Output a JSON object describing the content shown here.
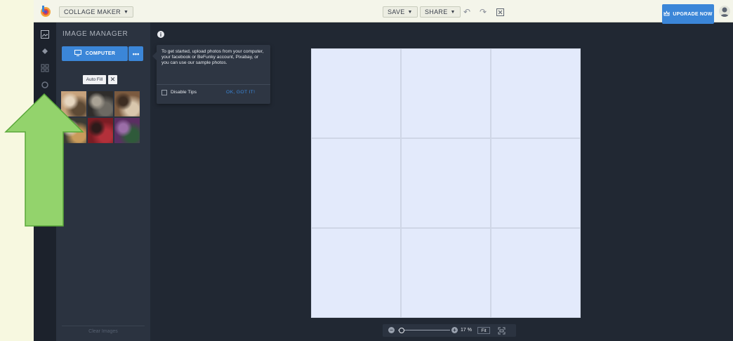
{
  "topbar": {
    "mode_label": "COLLAGE MAKER",
    "save_label": "SAVE",
    "share_label": "SHARE",
    "upgrade_label": "UPGRADE NOW"
  },
  "panel": {
    "title": "IMAGE MANAGER",
    "computer_label": "COMPUTER",
    "more_label": "•••",
    "autofill_label": "Auto Fill",
    "autofill_close": "✕",
    "clear_label": "Clear Images",
    "thumbnails": [
      {
        "name": "thumb-woman-portrait",
        "colors": [
          "#c7a27c",
          "#5e4a35",
          "#e6d6c0"
        ]
      },
      {
        "name": "thumb-headphones",
        "colors": [
          "#2f2d2b",
          "#6d6a63",
          "#a9a295"
        ]
      },
      {
        "name": "thumb-coffee",
        "colors": [
          "#7b5a3f",
          "#d9c7ad",
          "#3d2d22"
        ]
      },
      {
        "name": "thumb-bread-vegetables",
        "colors": [
          "#3a3a34",
          "#c99b5b",
          "#d8d0c2"
        ]
      },
      {
        "name": "thumb-raspberries",
        "colors": [
          "#7a1d24",
          "#b3303a",
          "#2d1a1a"
        ]
      },
      {
        "name": "thumb-purple-plant",
        "colors": [
          "#5b2e62",
          "#2f5a3a",
          "#9b6ea8"
        ]
      }
    ]
  },
  "tip": {
    "text": "To get started, upload photos from your computer, your facebook or BeFunky account, Pixabay, or you can use our sample photos.",
    "disable_label": "Disable Tips",
    "ok_label": "OK, GOT IT!"
  },
  "zoom": {
    "minus": "−",
    "plus": "+",
    "percent_label": "17 %",
    "fit_label": "Fit",
    "value_fraction": 0.05
  },
  "colors": {
    "accent": "#3b86d8",
    "arrow_fill": "#93d36c",
    "arrow_stroke": "#5aa83a",
    "canvas": "#e3eafb",
    "app_bg": "#212833"
  }
}
